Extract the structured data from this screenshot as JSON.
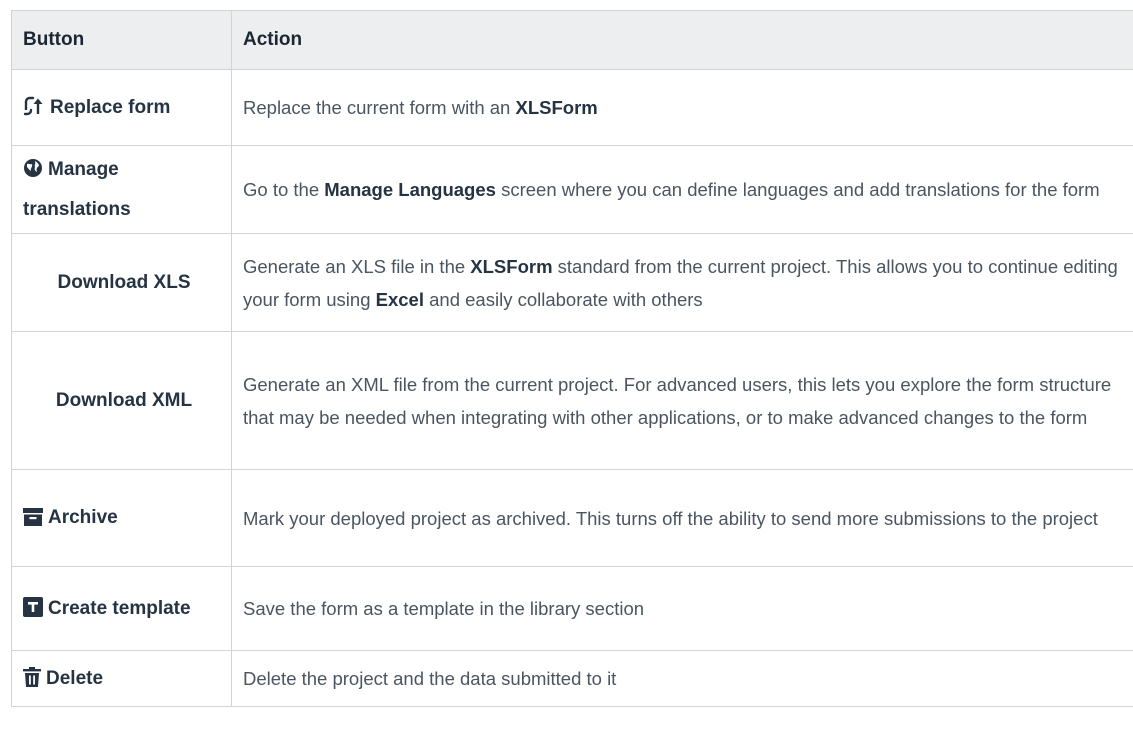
{
  "table": {
    "headers": {
      "button": "Button",
      "action": "Action"
    },
    "rows": [
      {
        "button": "Replace form",
        "icon": "replace-icon",
        "action": [
          {
            "text": "Replace the current form with an ",
            "bold": false
          },
          {
            "text": "XLSForm",
            "bold": true
          }
        ]
      },
      {
        "button": "Manage translations",
        "icon": "globe-icon",
        "action": [
          {
            "text": "Go to the ",
            "bold": false
          },
          {
            "text": "Manage Languages",
            "bold": true
          },
          {
            "text": " screen where you can define languages and add translations for the form",
            "bold": false
          }
        ]
      },
      {
        "button": "Download XLS",
        "icon": "",
        "action": [
          {
            "text": "Generate an XLS file in the ",
            "bold": false
          },
          {
            "text": "XLSForm",
            "bold": true
          },
          {
            "text": " standard from the current project. This allows you to continue editing your form using ",
            "bold": false
          },
          {
            "text": "Excel",
            "bold": true
          },
          {
            "text": " and easily collaborate with others",
            "bold": false
          }
        ]
      },
      {
        "button": "Download XML",
        "icon": "",
        "action": [
          {
            "text": "Generate an XML file from the current project. For advanced users, this lets you explore the form structure that may be needed when integrating with other applications, or to make advanced changes to the form",
            "bold": false
          }
        ]
      },
      {
        "button": "Archive",
        "icon": "archive-icon",
        "action": [
          {
            "text": "Mark your deployed project as archived. This turns off the ability to send more submissions to the project",
            "bold": false
          }
        ]
      },
      {
        "button": "Create template",
        "icon": "template-icon",
        "action": [
          {
            "text": "Save the form as a template in the library section",
            "bold": false
          }
        ]
      },
      {
        "button": "Delete",
        "icon": "trash-icon",
        "action": [
          {
            "text": "Delete the project and the data submitted to it",
            "bold": false
          }
        ]
      }
    ]
  }
}
